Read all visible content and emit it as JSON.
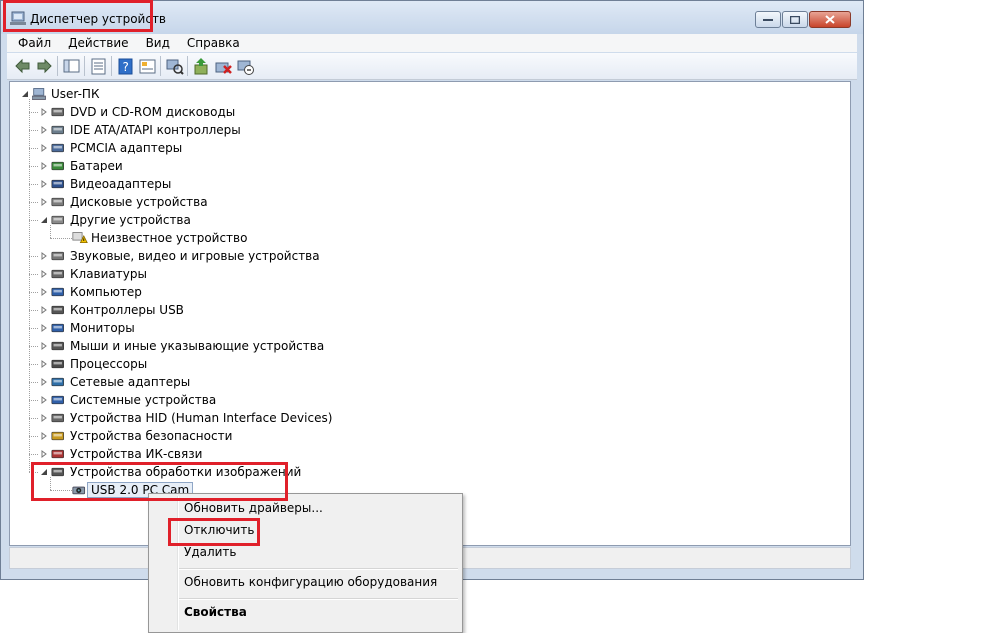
{
  "window": {
    "title": "Диспетчер устройств"
  },
  "menu": [
    "Файл",
    "Действие",
    "Вид",
    "Справка"
  ],
  "toolbar": [
    "back-icon",
    "forward-icon",
    "sep",
    "console-tree-icon",
    "sep",
    "properties-icon",
    "sep",
    "help-icon",
    "show-hide-icon",
    "sep",
    "scan-hardware-icon",
    "sep",
    "update-driver-icon",
    "uninstall-icon",
    "disable-icon"
  ],
  "tree": {
    "root": "User-ПК",
    "categories": [
      {
        "label": "DVD и CD-ROM дисководы",
        "icon": "dvd-drive-icon",
        "color": "#6b6b6b"
      },
      {
        "label": "IDE ATA/ATAPI контроллеры",
        "icon": "ide-controller-icon",
        "color": "#6b7d8c"
      },
      {
        "label": "PCMCIA адаптеры",
        "icon": "pcmcia-icon",
        "color": "#4a6a9a"
      },
      {
        "label": "Батареи",
        "icon": "battery-icon",
        "color": "#3a8a3a"
      },
      {
        "label": "Видеоадаптеры",
        "icon": "video-adapter-icon",
        "color": "#2c4f8c"
      },
      {
        "label": "Дисковые устройства",
        "icon": "disk-drive-icon",
        "color": "#7c7c7c"
      },
      {
        "label": "Другие устройства",
        "icon": "other-devices-icon",
        "color": "#8a8a8a",
        "expanded": true,
        "children": [
          {
            "label": "Неизвестное устройство",
            "icon": "unknown-device-warning-icon"
          }
        ]
      },
      {
        "label": "Звуковые, видео и игровые устройства",
        "icon": "speaker-icon",
        "color": "#777777"
      },
      {
        "label": "Клавиатуры",
        "icon": "keyboard-icon",
        "color": "#666666"
      },
      {
        "label": "Компьютер",
        "icon": "computer-icon",
        "color": "#2f5fa8"
      },
      {
        "label": "Контроллеры USB",
        "icon": "usb-icon",
        "color": "#555555"
      },
      {
        "label": "Мониторы",
        "icon": "monitor-icon",
        "color": "#2f5fa8"
      },
      {
        "label": "Мыши и иные указывающие устройства",
        "icon": "mouse-icon",
        "color": "#555555"
      },
      {
        "label": "Процессоры",
        "icon": "processor-icon",
        "color": "#4a4a4a"
      },
      {
        "label": "Сетевые адаптеры",
        "icon": "network-adapter-icon",
        "color": "#2f6fa8"
      },
      {
        "label": "Системные устройства",
        "icon": "system-devices-icon",
        "color": "#2f5fa8"
      },
      {
        "label": "Устройства HID (Human Interface Devices)",
        "icon": "hid-icon",
        "color": "#666666"
      },
      {
        "label": "Устройства безопасности",
        "icon": "security-device-icon",
        "color": "#c89a20"
      },
      {
        "label": "Устройства ИК-связи",
        "icon": "infrared-icon",
        "color": "#aa3333"
      },
      {
        "label": "Устройства обработки изображений",
        "icon": "imaging-device-icon",
        "color": "#555555",
        "expanded": true,
        "children": [
          {
            "label": "USB 2.0 PC Cam",
            "icon": "webcam-icon",
            "selected": true
          }
        ]
      }
    ]
  },
  "context_menu": {
    "update_drivers": "Обновить драйверы...",
    "disable": "Отключить",
    "uninstall": "Удалить",
    "scan": "Обновить конфигурацию оборудования",
    "properties": "Свойства"
  },
  "colors": {
    "highlight": "#e0202a",
    "window_frame": "#cfdcec",
    "selection": "#e7eef7"
  }
}
